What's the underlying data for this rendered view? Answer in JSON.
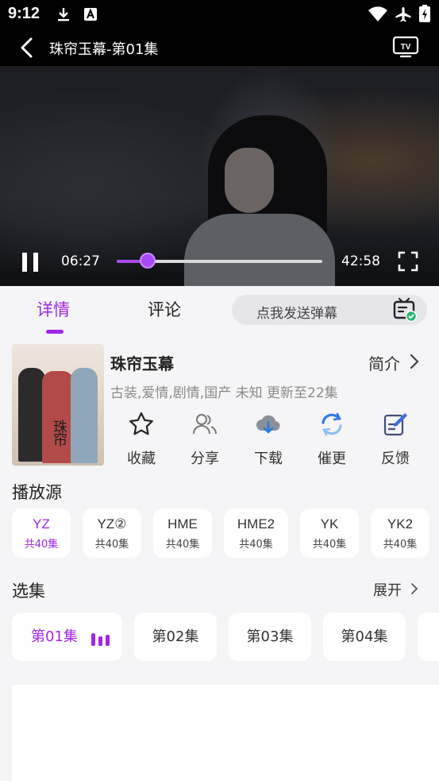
{
  "status_bar": {
    "time": "9:12",
    "icons": [
      "download-icon",
      "font-a-icon",
      "wifi-icon",
      "airplane-icon",
      "battery-charging-icon"
    ]
  },
  "player": {
    "title": "珠帘玉幕-第01集",
    "current_time": "06:27",
    "total_time": "42:58",
    "progress": 0.15,
    "accent_color": "#a64bf4"
  },
  "tabs": [
    {
      "label": "详情",
      "active": true
    },
    {
      "label": "评论",
      "active": false
    }
  ],
  "danmaku": {
    "placeholder": "点我发送弹幕"
  },
  "show": {
    "title": "珠帘玉幕",
    "intro_link": "简介",
    "meta": "古装,爱情,剧情,国产 未知 更新至22集",
    "poster_text": "珠帘玉幕"
  },
  "actions": [
    {
      "label": "收藏",
      "icon": "star-icon"
    },
    {
      "label": "分享",
      "icon": "share-people-icon"
    },
    {
      "label": "下载",
      "icon": "cloud-download-icon"
    },
    {
      "label": "催更",
      "icon": "refresh-icon"
    },
    {
      "label": "反馈",
      "icon": "feedback-edit-icon"
    }
  ],
  "sources": {
    "title": "播放源",
    "items": [
      {
        "name": "YZ",
        "count": "共40集",
        "active": true
      },
      {
        "name": "YZ②",
        "count": "共40集",
        "active": false
      },
      {
        "name": "HME",
        "count": "共40集",
        "active": false
      },
      {
        "name": "HME2",
        "count": "共40集",
        "active": false
      },
      {
        "name": "YK",
        "count": "共40集",
        "active": false
      },
      {
        "name": "YK2",
        "count": "共40集",
        "active": false
      }
    ]
  },
  "episodes": {
    "title": "选集",
    "expand_label": "展开",
    "items": [
      {
        "label": "第01集",
        "active": true
      },
      {
        "label": "第02集",
        "active": false
      },
      {
        "label": "第03集",
        "active": false
      },
      {
        "label": "第04集",
        "active": false
      }
    ]
  }
}
